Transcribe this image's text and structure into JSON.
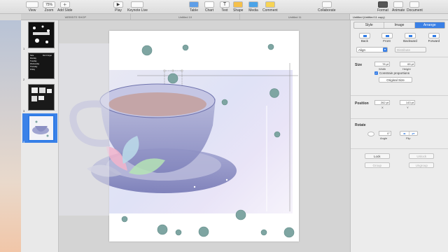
{
  "toolbar": {
    "view": "View",
    "zoom_value": "75%",
    "zoom": "Zoom",
    "add_slide": "Add Slide",
    "play": "Play",
    "keynote_live": "Keynote Live",
    "table": "Table",
    "chart": "Chart",
    "text": "Text",
    "shape": "Shape",
    "media": "Media",
    "comment": "Comment",
    "collaborate": "Collaborate",
    "format": "Format",
    "animate": "Animate",
    "document": "Document"
  },
  "tabs": [
    "WEBSITE SHOP",
    "Untitled 10",
    "Untitled 11"
  ],
  "active_doc_tab": "Untitled (Untitled 11 copy)",
  "navigator": {
    "slide_numbers": [
      "1",
      "2",
      "3",
      "4"
    ],
    "thumb_texts": {
      "t2": [
        "Note",
        "Monday",
        "Tuesday",
        "Wednesday",
        "Thursday",
        "Friday"
      ],
      "t2b": [
        "Don't forget"
      ]
    }
  },
  "inspector": {
    "tabs": [
      "Style",
      "Image",
      "Arrange"
    ],
    "arrange_buttons": [
      "Back",
      "Front",
      "Backward",
      "Forward"
    ],
    "align": "Align",
    "distribute": "Distribute",
    "size_label": "Size",
    "width_value": "78 pt",
    "height_value": "65 pt",
    "width_label": "Width",
    "height_label": "Height",
    "constrain": "Constrain proportions",
    "original_size": "Original Size",
    "position_label": "Position",
    "x_value": "262 pt",
    "y_value": "143 pt",
    "x_label": "X",
    "y_label": "Y",
    "rotate_label": "Rotate",
    "angle_value": "0°",
    "angle_label": "Angle",
    "flip_label": "Flip",
    "lock": "Lock",
    "unlock": "Unlock",
    "group": "Group",
    "ungroup": "Ungroup"
  },
  "colors": {
    "accent": "#3a80e6",
    "bubble": "#7ea5a2",
    "cup": "#8f93c4"
  }
}
